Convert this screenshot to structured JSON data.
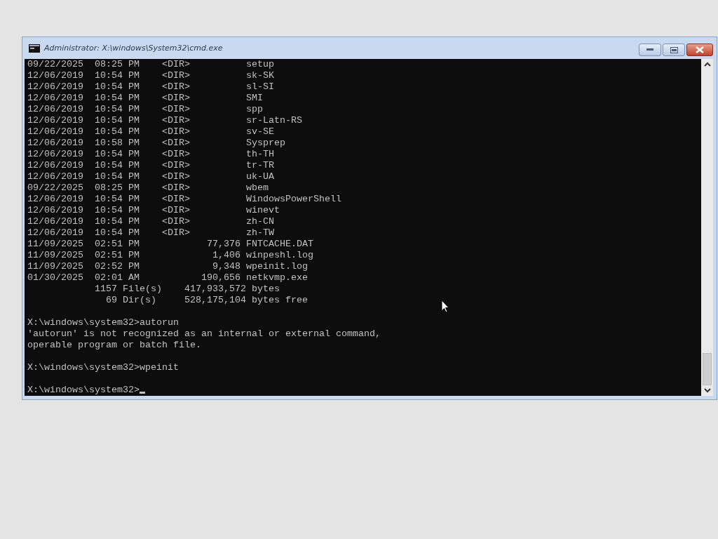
{
  "window": {
    "title": "Administrator: X:\\windows\\System32\\cmd.exe"
  },
  "console": {
    "blocks": [
      [
        "09/22/2025  08:25 PM    <DIR>          setup",
        "12/06/2019  10:54 PM    <DIR>          sk-SK",
        "12/06/2019  10:54 PM    <DIR>          sl-SI",
        "12/06/2019  10:54 PM    <DIR>          SMI",
        "12/06/2019  10:54 PM    <DIR>          spp",
        "12/06/2019  10:54 PM    <DIR>          sr-Latn-RS",
        "12/06/2019  10:54 PM    <DIR>          sv-SE",
        "12/06/2019  10:58 PM    <DIR>          Sysprep",
        "12/06/2019  10:54 PM    <DIR>          th-TH",
        "12/06/2019  10:54 PM    <DIR>          tr-TR",
        "12/06/2019  10:54 PM    <DIR>          uk-UA",
        "09/22/2025  08:25 PM    <DIR>          wbem",
        "12/06/2019  10:54 PM    <DIR>          WindowsPowerShell",
        "12/06/2019  10:54 PM    <DIR>          winevt",
        "12/06/2019  10:54 PM    <DIR>          zh-CN",
        "12/06/2019  10:54 PM    <DIR>          zh-TW",
        "11/09/2025  02:51 PM            77,376 FNTCACHE.DAT",
        "11/09/2025  02:51 PM             1,406 winpeshl.log",
        "11/09/2025  02:52 PM             9,348 wpeinit.log",
        "01/30/2025  02:01 AM           190,656 netkvmp.exe",
        "            1157 File(s)    417,933,572 bytes",
        "              69 Dir(s)     528,175,104 bytes free"
      ],
      [
        "X:\\windows\\system32>autorun",
        "'autorun' is not recognized as an internal or external command,",
        "operable program or batch file."
      ],
      [
        "X:\\windows\\system32>wpeinit"
      ],
      [
        "X:\\windows\\system32>"
      ]
    ]
  }
}
